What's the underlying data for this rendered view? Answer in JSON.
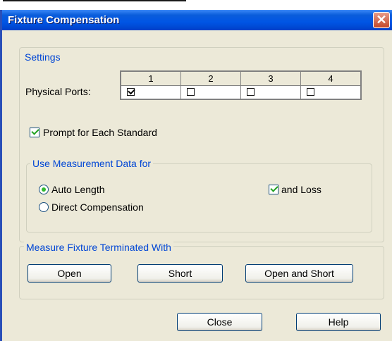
{
  "dialog": {
    "title": "Fixture Compensation",
    "close_glyph": "✕"
  },
  "settings": {
    "group_label": "Settings",
    "physical_ports_label": "Physical Ports:",
    "ports": [
      {
        "number": "1",
        "checked": true
      },
      {
        "number": "2",
        "checked": false
      },
      {
        "number": "3",
        "checked": false
      },
      {
        "number": "4",
        "checked": false
      }
    ],
    "prompt_label": "Prompt for Each Standard",
    "prompt_checked": true
  },
  "measurement": {
    "group_label": "Use Measurement Data for",
    "auto_length_label": "Auto Length",
    "auto_length_selected": true,
    "direct_comp_label": "Direct Compensation",
    "direct_comp_selected": false,
    "and_loss_label": "and Loss",
    "and_loss_checked": true
  },
  "fixture": {
    "group_label": "Measure Fixture Terminated With",
    "open_label": "Open",
    "short_label": "Short",
    "open_short_label": "Open and Short"
  },
  "footer": {
    "close_label": "Close",
    "help_label": "Help"
  },
  "colors": {
    "title_bar": "#0055e5",
    "group_label": "#0046d5",
    "check_green": "#21a121"
  }
}
